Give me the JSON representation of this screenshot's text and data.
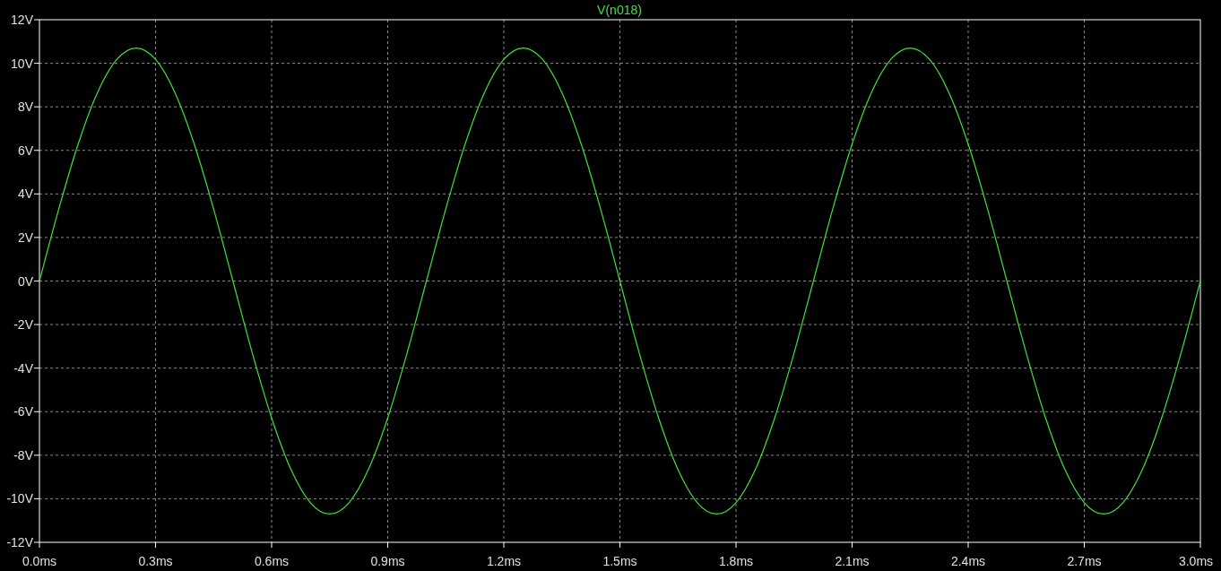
{
  "plot": {
    "chart_data": {
      "type": "line",
      "grid": true,
      "xlim": [
        0,
        3.0
      ],
      "ylim": [
        -12,
        12
      ],
      "xticks": [
        {
          "value": 0,
          "label": "0.0ms"
        },
        {
          "value": 0.3,
          "label": "0.3ms"
        },
        {
          "value": 0.6,
          "label": "0.6ms"
        },
        {
          "value": 0.9,
          "label": "0.9ms"
        },
        {
          "value": 1.2,
          "label": "1.2ms"
        },
        {
          "value": 1.5,
          "label": "1.5ms"
        },
        {
          "value": 1.8,
          "label": "1.8ms"
        },
        {
          "value": 2.1,
          "label": "2.1ms"
        },
        {
          "value": 2.4,
          "label": "2.4ms"
        },
        {
          "value": 2.7,
          "label": "2.7ms"
        },
        {
          "value": 3.0,
          "label": "3.0ms"
        }
      ],
      "yticks": [
        {
          "value": 12,
          "label": "12V"
        },
        {
          "value": 10,
          "label": "10V"
        },
        {
          "value": 8,
          "label": "8V"
        },
        {
          "value": 6,
          "label": "6V"
        },
        {
          "value": 4,
          "label": "4V"
        },
        {
          "value": 2,
          "label": "2V"
        },
        {
          "value": 0,
          "label": "0V"
        },
        {
          "value": -2,
          "label": "-2V"
        },
        {
          "value": -4,
          "label": "-4V"
        },
        {
          "value": -6,
          "label": "-6V"
        },
        {
          "value": -8,
          "label": "-8V"
        },
        {
          "value": -10,
          "label": "-10V"
        },
        {
          "value": -12,
          "label": "-12V"
        }
      ],
      "x": [
        0,
        0.05,
        0.1,
        0.15,
        0.2,
        0.25,
        0.3,
        0.35,
        0.4,
        0.45,
        0.5,
        0.55,
        0.6,
        0.65,
        0.7,
        0.75,
        0.8,
        0.85,
        0.9,
        0.95,
        1.0,
        1.05,
        1.1,
        1.15,
        1.2,
        1.25,
        1.3,
        1.35,
        1.4,
        1.45,
        1.5,
        1.55,
        1.6,
        1.65,
        1.7,
        1.75,
        1.8,
        1.85,
        1.9,
        1.95,
        2.0,
        2.05,
        2.1,
        2.15,
        2.2,
        2.25,
        2.3,
        2.35,
        2.4,
        2.45,
        2.5,
        2.55,
        2.6,
        2.65,
        2.7,
        2.75,
        2.8,
        2.85,
        2.9,
        2.95,
        3.0
      ],
      "series": [
        {
          "name": "V(n018)",
          "color": "#40e040",
          "values": [
            0,
            3.31,
            6.29,
            8.66,
            10.18,
            10.7,
            10.18,
            8.66,
            6.29,
            3.31,
            0,
            -3.31,
            -6.29,
            -8.66,
            -10.18,
            -10.7,
            -10.18,
            -8.66,
            -6.29,
            -3.31,
            0,
            3.31,
            6.29,
            8.66,
            10.18,
            10.7,
            10.18,
            8.66,
            6.29,
            3.31,
            0,
            -3.31,
            -6.29,
            -8.66,
            -10.18,
            -10.7,
            -10.18,
            -8.66,
            -6.29,
            -3.31,
            0,
            3.31,
            6.29,
            8.66,
            10.18,
            10.7,
            10.18,
            8.66,
            6.29,
            3.31,
            0,
            -3.31,
            -6.29,
            -8.66,
            -10.18,
            -10.7,
            -10.18,
            -8.66,
            -6.29,
            -3.31,
            0
          ]
        }
      ]
    }
  }
}
